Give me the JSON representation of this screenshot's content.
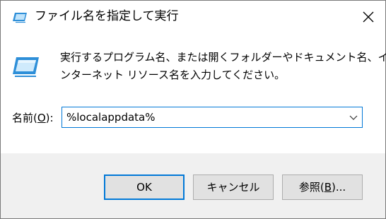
{
  "window": {
    "title": "ファイル名を指定して実行",
    "close_glyph": "✕"
  },
  "description": {
    "line1": "実行するプログラム名、または開くフォルダーやドキュメント名、イ",
    "line2": "ンターネット リソース名を入力してください。"
  },
  "name_field": {
    "label_prefix": "名前(",
    "label_accel": "O",
    "label_suffix": "):",
    "value": "%localappdata%"
  },
  "buttons": {
    "ok": "OK",
    "cancel": "キャンセル",
    "browse_prefix": "参照(",
    "browse_accel": "B",
    "browse_suffix": ")..."
  },
  "icons": {
    "title": "run-icon",
    "body": "run-icon",
    "close": "close-icon",
    "dropdown": "chevron-down-icon"
  },
  "colors": {
    "accent": "#0078d7",
    "footer_bg": "#f0f0f0",
    "button_bg": "#e1e1e1"
  }
}
